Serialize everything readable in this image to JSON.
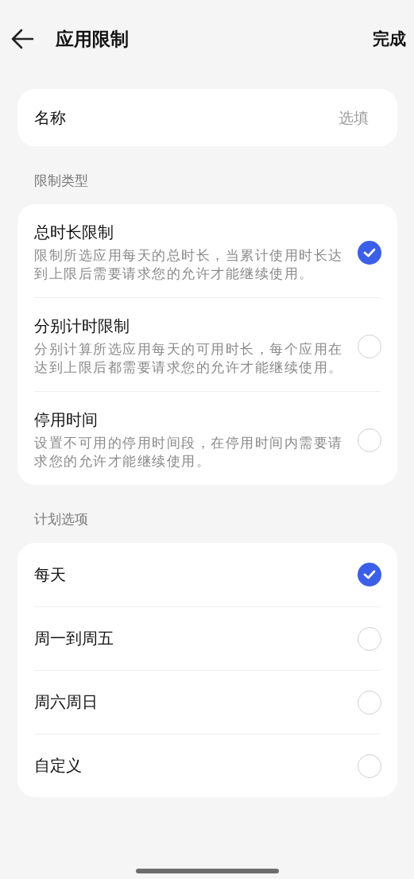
{
  "header": {
    "title": "应用限制",
    "action": "完成"
  },
  "name_field": {
    "label": "名称",
    "placeholder": "选填"
  },
  "sections": [
    {
      "label": "限制类型",
      "options": [
        {
          "title": "总时长限制",
          "description": "限制所选应用每天的总时长，当累计使用时长达到上限后需要请求您的允许才能继续使用。",
          "selected": true
        },
        {
          "title": "分别计时限制",
          "description": "分别计算所选应用每天的可用时长，每个应用在达到上限后都需要请求您的允许才能继续使用。",
          "selected": false
        },
        {
          "title": "停用时间",
          "description": "设置不可用的停用时间段，在停用时间内需要请求您的允许才能继续使用。",
          "selected": false
        }
      ]
    },
    {
      "label": "计划选项",
      "options": [
        {
          "title": "每天",
          "selected": true
        },
        {
          "title": "周一到周五",
          "selected": false
        },
        {
          "title": "周六周日",
          "selected": false
        },
        {
          "title": "自定义",
          "selected": false
        }
      ]
    }
  ]
}
